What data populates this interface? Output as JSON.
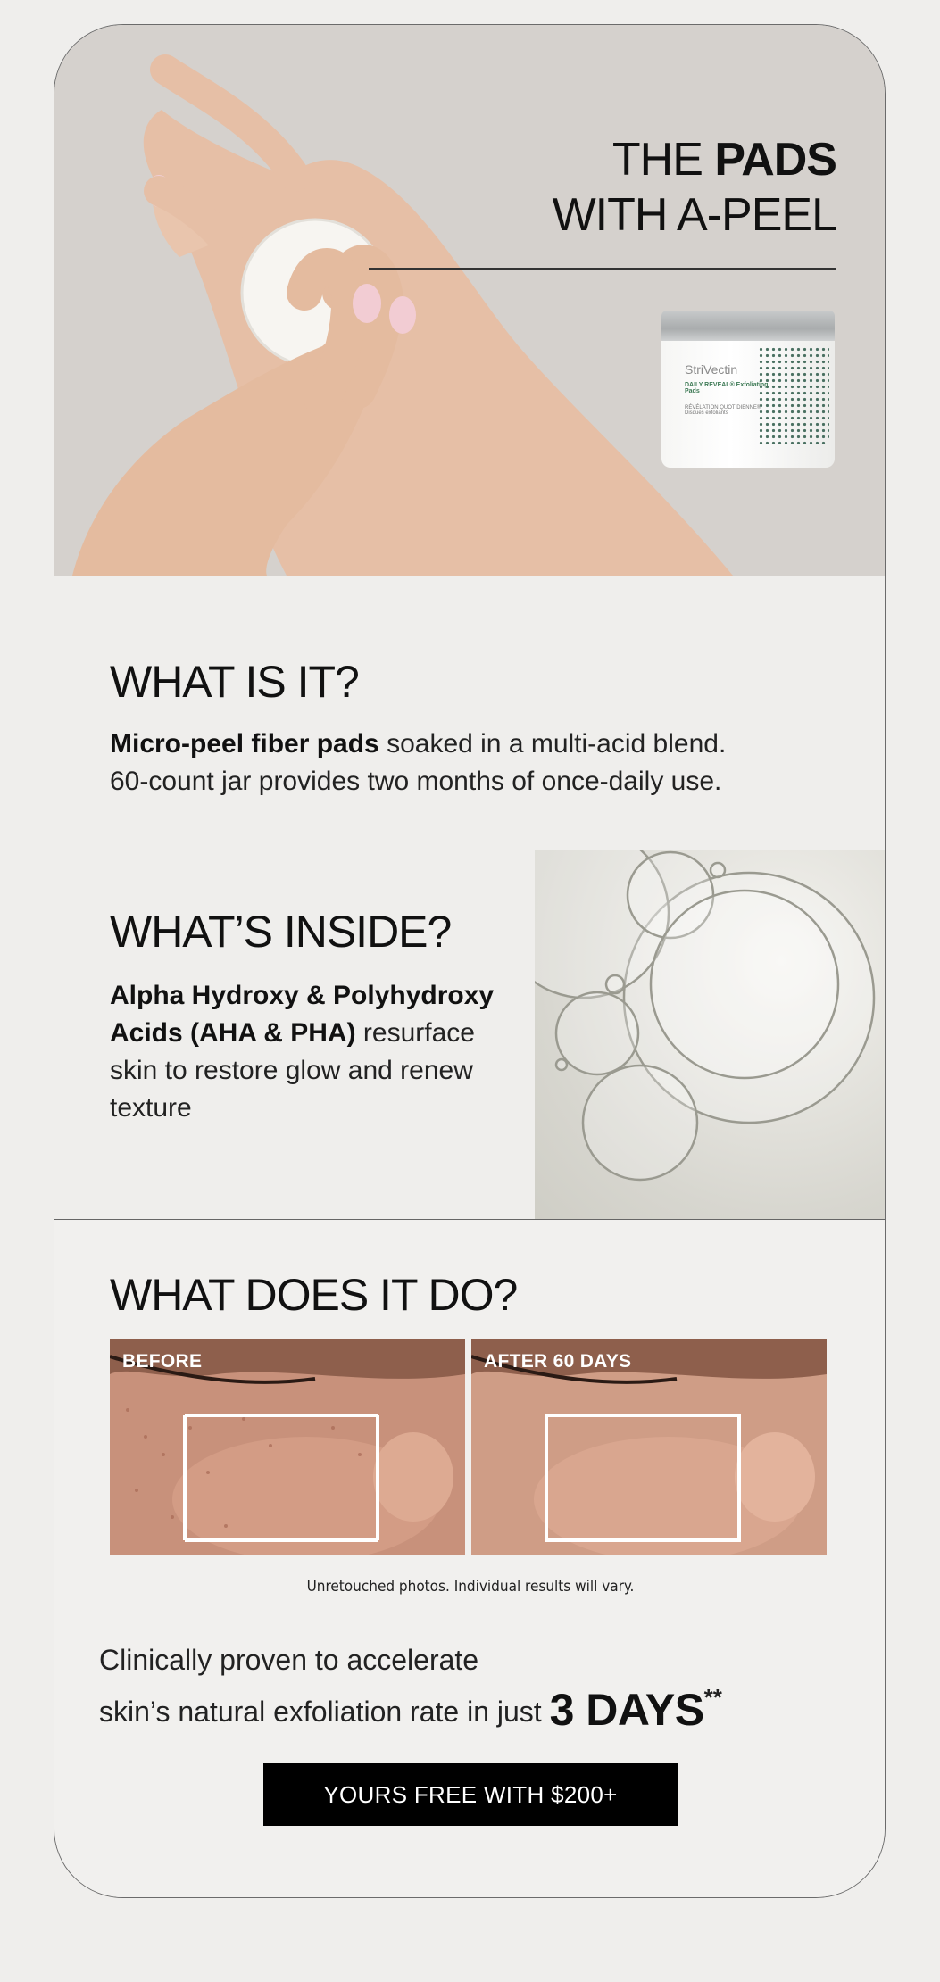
{
  "hero": {
    "title_line1_light": "THE ",
    "title_line1_bold": "PADS",
    "title_line2": "WITH A-PEEL",
    "jar": {
      "brand": "StriVectin",
      "line1": "DAILY REVEAL® Exfoliating Pads",
      "line2": "RÉVÉLATION QUOTIDIENNE® Disques exfoliants"
    }
  },
  "what_is_it": {
    "heading": "WHAT IS IT?",
    "bold_text": "Micro-peel fiber pads",
    "text_rest": " soaked in a multi-acid blend.",
    "text_line2": "60-count jar provides two months of once-daily use."
  },
  "whats_inside": {
    "heading": "WHAT’S INSIDE?",
    "bold_text": "Alpha Hydroxy & Polyhydroxy Acids (AHA & PHA)",
    "text_rest": " resurface skin to restore glow and renew texture"
  },
  "what_does_it_do": {
    "heading": "WHAT DOES IT DO?",
    "before_label": "BEFORE",
    "after_label": "AFTER 60 DAYS",
    "disclaimer": "Unretouched photos. Individual results will vary.",
    "claim_line1": "Clinically proven to accelerate",
    "claim_line2": "skin’s natural exfoliation rate in just ",
    "claim_big": "3 DAYS",
    "claim_sup": "**"
  },
  "cta": {
    "label": "YOURS FREE WITH $200+"
  },
  "colors": {
    "page_bg": "#efeeec",
    "hero_bg": "#d5d1cd",
    "cta_bg": "#000000",
    "jar_accent": "#2e5b4a"
  }
}
